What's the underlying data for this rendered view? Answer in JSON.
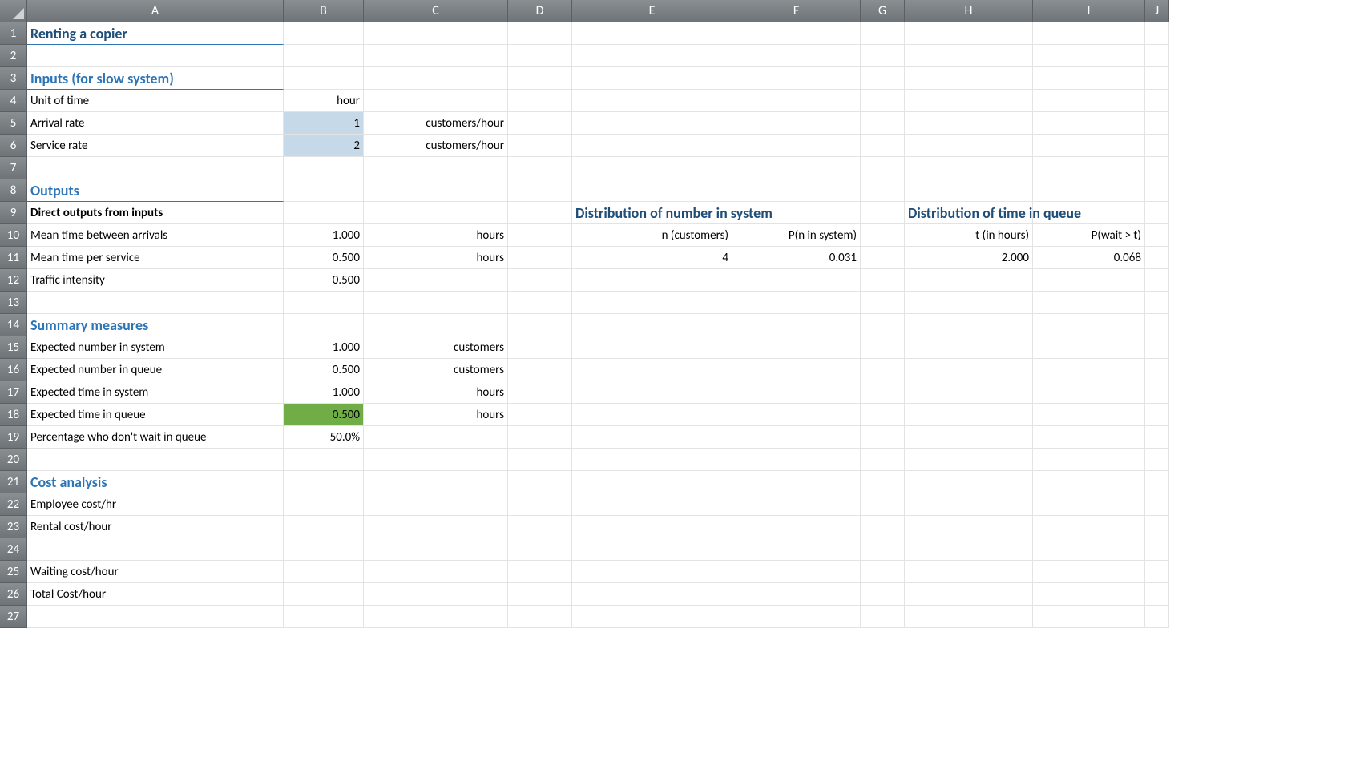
{
  "columns": [
    "A",
    "B",
    "C",
    "D",
    "E",
    "F",
    "G",
    "H",
    "I",
    "J"
  ],
  "rows": [
    "1",
    "2",
    "3",
    "4",
    "5",
    "6",
    "7",
    "8",
    "9",
    "10",
    "11",
    "12",
    "13",
    "14",
    "15",
    "16",
    "17",
    "18",
    "19",
    "20",
    "21",
    "22",
    "23",
    "24",
    "25",
    "26",
    "27"
  ],
  "A": {
    "1": "Renting a copier",
    "3": "Inputs (for slow system)",
    "4": "Unit of time",
    "5": "Arrival rate",
    "6": "Service rate",
    "8": "Outputs",
    "9": "Direct outputs from inputs",
    "10": "Mean time between arrivals",
    "11": "Mean time per service",
    "12": "Traffic intensity",
    "14": "Summary measures",
    "15": "Expected number in system",
    "16": "Expected number in queue",
    "17": "Expected time in system",
    "18": "Expected time in queue",
    "19": "Percentage who don't wait in queue",
    "21": "Cost analysis",
    "22": "Employee cost/hr",
    "23": "Rental cost/hour",
    "25": "Waiting cost/hour",
    "26": "Total Cost/hour"
  },
  "B": {
    "4": "hour",
    "5": "1",
    "6": "2",
    "10": "1.000",
    "11": "0.500",
    "12": "0.500",
    "15": "1.000",
    "16": "0.500",
    "17": "1.000",
    "18": "0.500",
    "19": "50.0%"
  },
  "C": {
    "5": "customers/hour",
    "6": "customers/hour",
    "10": "hours",
    "11": "hours",
    "15": "customers",
    "16": "customers",
    "17": "hours",
    "18": "hours"
  },
  "E": {
    "9": "Distribution of number in system",
    "10": "n (customers)",
    "11": "4"
  },
  "F": {
    "10": "P(n in system)",
    "11": "0.031"
  },
  "H": {
    "9": "Distribution of time in queue",
    "10": "t (in hours)",
    "11": "2.000"
  },
  "I": {
    "10": "P(wait > t)",
    "11": "0.068"
  },
  "chart_data": {
    "type": "table",
    "title": "Renting a copier — M/M/1 queue (slow system)",
    "inputs": {
      "unit_of_time": "hour",
      "arrival_rate": 1,
      "service_rate": 2,
      "rate_units": "customers/hour"
    },
    "direct_outputs": {
      "mean_time_between_arrivals": 1.0,
      "mean_time_per_service": 0.5,
      "traffic_intensity": 0.5,
      "time_units": "hours"
    },
    "summary_measures": {
      "expected_number_in_system": 1.0,
      "expected_number_in_queue": 0.5,
      "expected_time_in_system": 1.0,
      "expected_time_in_queue": 0.5,
      "percentage_who_dont_wait_in_queue": 0.5
    },
    "distribution_number_in_system": {
      "n_customers": 4,
      "P_n_in_system": 0.031
    },
    "distribution_time_in_queue": {
      "t_hours": 2.0,
      "P_wait_gt_t": 0.068
    },
    "cost_analysis": {
      "employee_cost_per_hour": null,
      "rental_cost_per_hour": null,
      "waiting_cost_per_hour": null,
      "total_cost_per_hour": null
    }
  }
}
